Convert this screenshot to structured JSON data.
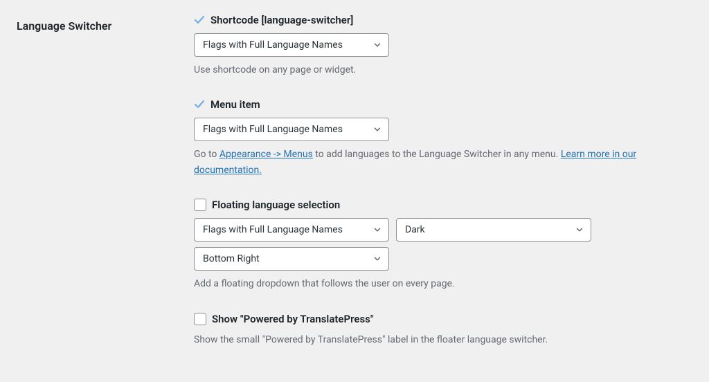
{
  "sidebar": {
    "title": "Language Switcher"
  },
  "shortcode": {
    "title": "Shortcode [language-switcher]",
    "select_value": "Flags with Full Language Names",
    "helper": "Use shortcode on any page or widget."
  },
  "menu_item": {
    "title": "Menu item",
    "select_value": "Flags with Full Language Names",
    "helper_prefix": "Go to ",
    "link1": "Appearance -> Menus",
    "helper_mid": " to add languages to the Language Switcher in any menu. ",
    "link2": "Learn more in our documentation."
  },
  "floating": {
    "title": "Floating language selection",
    "select1_value": "Flags with Full Language Names",
    "select2_value": "Dark",
    "select3_value": "Bottom Right",
    "helper": "Add a floating dropdown that follows the user on every page."
  },
  "powered": {
    "title": "Show \"Powered by TranslatePress\"",
    "helper": "Show the small \"Powered by TranslatePress\" label in the floater language switcher."
  }
}
